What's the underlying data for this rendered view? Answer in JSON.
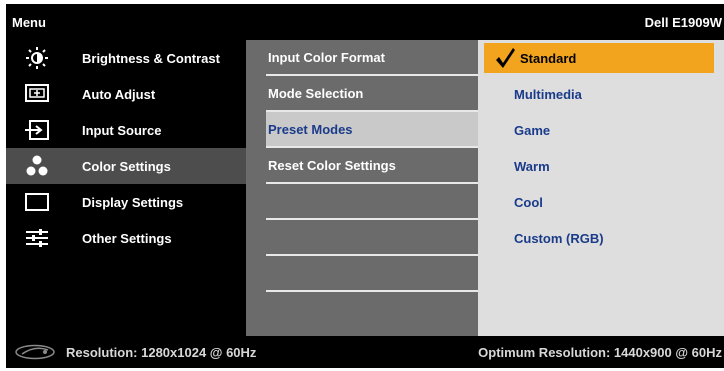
{
  "header": {
    "title": "Menu",
    "model": "Dell E1909W"
  },
  "main_menu": {
    "selected_index": 3,
    "items": [
      {
        "label": "Brightness & Contrast",
        "icon": "brightness-icon"
      },
      {
        "label": "Auto Adjust",
        "icon": "auto-adjust-icon"
      },
      {
        "label": "Input Source",
        "icon": "input-source-icon"
      },
      {
        "label": "Color Settings",
        "icon": "color-settings-icon"
      },
      {
        "label": "Display Settings",
        "icon": "display-settings-icon"
      },
      {
        "label": "Other Settings",
        "icon": "other-settings-icon"
      }
    ]
  },
  "submenu": {
    "selected_index": 2,
    "items": [
      {
        "label": "Input Color Format"
      },
      {
        "label": "Mode Selection"
      },
      {
        "label": "Preset Modes"
      },
      {
        "label": "Reset Color Settings"
      },
      {
        "label": ""
      },
      {
        "label": ""
      },
      {
        "label": ""
      }
    ]
  },
  "options": {
    "selected_index": 0,
    "items": [
      {
        "label": "Standard"
      },
      {
        "label": "Multimedia"
      },
      {
        "label": "Game"
      },
      {
        "label": "Warm"
      },
      {
        "label": "Cool"
      },
      {
        "label": "Custom (RGB)"
      }
    ]
  },
  "footer": {
    "logo": "energy-star-logo",
    "resolution": "Resolution: 1280x1024 @ 60Hz",
    "optimum": "Optimum Resolution: 1440x900 @ 60Hz"
  },
  "colors": {
    "selected_option": "#f2a41e",
    "selected_main_item": "#4d4d4d",
    "submenu_bg": "#6b6b6b",
    "options_bg": "#dedede",
    "option_text": "#1a3b8a"
  }
}
